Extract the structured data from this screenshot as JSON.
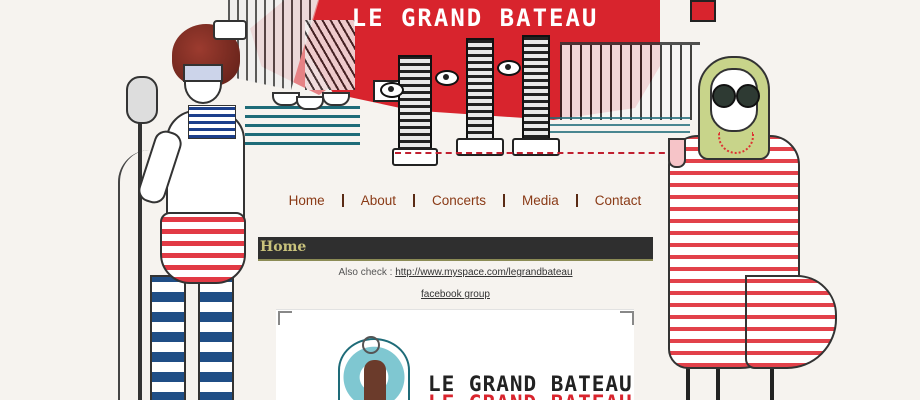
{
  "site": {
    "title": "LE GRAND BATEAU"
  },
  "nav": {
    "items": [
      {
        "label": "Home"
      },
      {
        "label": "About"
      },
      {
        "label": "Concerts"
      },
      {
        "label": "Media"
      },
      {
        "label": "Contact"
      }
    ]
  },
  "content": {
    "heading": "Home",
    "also_check_prefix": "Also check : ",
    "myspace_link": "http://www.myspace.com/legrandbateau",
    "facebook_link": "facebook group",
    "logo_text": "LE GRAND BATEAU"
  },
  "colors": {
    "accent_red": "#d8242d",
    "nav_link": "#8a3a16",
    "heading_bar": "#2f2f2f",
    "heading_text": "#c9c27c",
    "background": "#f6f3ef"
  }
}
